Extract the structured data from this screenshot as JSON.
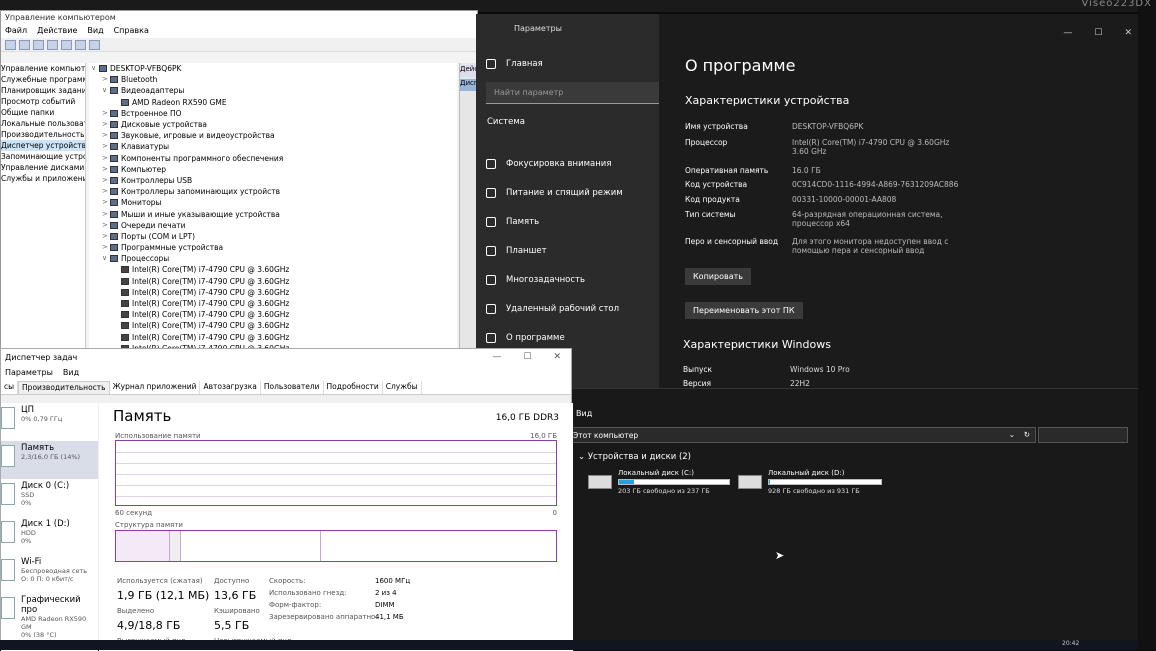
{
  "brand": "Viseo223DX",
  "device_manager": {
    "title": "Управление компьютером",
    "menu": [
      "Файл",
      "Действие",
      "Вид",
      "Справка"
    ],
    "left_items": [
      "Управление компьютером (л",
      "Служебные программы",
      "Планировщик задани",
      "Просмотр событий",
      "Общие папки",
      "Локальные пользовате",
      "Производительность",
      "Диспетчер устройств",
      "Запоминающие устройств",
      "Управление дисками",
      "Службы и приложения"
    ],
    "tree": [
      {
        "arrow": "∨",
        "label": "DESKTOP-VFBQ6PK",
        "indent": 0
      },
      {
        "arrow": ">",
        "label": "Bluetooth",
        "indent": 1
      },
      {
        "arrow": "∨",
        "label": "Видеоадаптеры",
        "indent": 1
      },
      {
        "arrow": "",
        "label": "AMD Radeon RX590 GME",
        "indent": 2
      },
      {
        "arrow": ">",
        "label": "Встроенное ПО",
        "indent": 1
      },
      {
        "arrow": ">",
        "label": "Дисковые устройства",
        "indent": 1
      },
      {
        "arrow": ">",
        "label": "Звуковые, игровые и видеоустройства",
        "indent": 1
      },
      {
        "arrow": ">",
        "label": "Клавиатуры",
        "indent": 1
      },
      {
        "arrow": ">",
        "label": "Компоненты программного обеспечения",
        "indent": 1
      },
      {
        "arrow": ">",
        "label": "Компьютер",
        "indent": 1
      },
      {
        "arrow": ">",
        "label": "Контроллеры USB",
        "indent": 1
      },
      {
        "arrow": ">",
        "label": "Контроллеры запоминающих устройств",
        "indent": 1
      },
      {
        "arrow": ">",
        "label": "Мониторы",
        "indent": 1
      },
      {
        "arrow": ">",
        "label": "Мыши и иные указывающие устройства",
        "indent": 1
      },
      {
        "arrow": ">",
        "label": "Очереди печати",
        "indent": 1
      },
      {
        "arrow": ">",
        "label": "Порты (COM и LPT)",
        "indent": 1
      },
      {
        "arrow": ">",
        "label": "Программные устройства",
        "indent": 1
      },
      {
        "arrow": "∨",
        "label": "Процессоры",
        "indent": 1
      },
      {
        "arrow": "",
        "label": "Intel(R) Core(TM) i7-4790 CPU @ 3.60GHz",
        "indent": 2,
        "cpu": true
      },
      {
        "arrow": "",
        "label": "Intel(R) Core(TM) i7-4790 CPU @ 3.60GHz",
        "indent": 2,
        "cpu": true
      },
      {
        "arrow": "",
        "label": "Intel(R) Core(TM) i7-4790 CPU @ 3.60GHz",
        "indent": 2,
        "cpu": true
      },
      {
        "arrow": "",
        "label": "Intel(R) Core(TM) i7-4790 CPU @ 3.60GHz",
        "indent": 2,
        "cpu": true
      },
      {
        "arrow": "",
        "label": "Intel(R) Core(TM) i7-4790 CPU @ 3.60GHz",
        "indent": 2,
        "cpu": true
      },
      {
        "arrow": "",
        "label": "Intel(R) Core(TM) i7-4790 CPU @ 3.60GHz",
        "indent": 2,
        "cpu": true
      },
      {
        "arrow": "",
        "label": "Intel(R) Core(TM) i7-4790 CPU @ 3.60GHz",
        "indent": 2,
        "cpu": true
      },
      {
        "arrow": "",
        "label": "Intel(R) Core(TM) i7-4790 CPU @ 3.60GHz",
        "indent": 2,
        "cpu": true
      }
    ],
    "right_pane": [
      "Дейс",
      "Дисп"
    ]
  },
  "settings": {
    "app_title": "Параметры",
    "home": "Главная",
    "search_placeholder": "Найти параметр",
    "section": "Система",
    "nav": [
      "Фокусировка внимания",
      "Питание и спящий режим",
      "Память",
      "Планшет",
      "Многозадачность",
      "Удаленный рабочий стол",
      "О программе"
    ],
    "page_title": "О программе",
    "device_specs_title": "Характеристики устройства",
    "specs": [
      {
        "k": "Имя устройства",
        "v": "DESKTOP-VFBQ6PK"
      },
      {
        "k": "Процессор",
        "v": "Intel(R) Core(TM) i7-4790 CPU @ 3.60GHz 3.60 GHz"
      },
      {
        "k": "Оперативная память",
        "v": "16.0 ГБ"
      },
      {
        "k": "Код устройства",
        "v": "0C914CD0-1116-4994-A869-7631209AC886"
      },
      {
        "k": "Код продукта",
        "v": "00331-10000-00001-AA808"
      },
      {
        "k": "Тип системы",
        "v": "64-разрядная операционная система, процессор x64"
      },
      {
        "k": "Перо и сенсорный ввод",
        "v": "Для этого монитора недоступен ввод с помощью пера и сенсорный ввод"
      }
    ],
    "copy_btn": "Копировать",
    "rename_btn": "Переименовать этот ПК",
    "windows_title": "Характеристики Windows",
    "win": [
      {
        "k": "Выпуск",
        "v": "Windows 10 Pro"
      },
      {
        "k": "Версия",
        "v": "22H2"
      }
    ],
    "controls": [
      "—",
      "☐",
      "✕"
    ]
  },
  "task_manager": {
    "title": "Диспетчер задач",
    "menu": [
      "Параметры",
      "Вид"
    ],
    "tabs": [
      "сы",
      "Производительность",
      "Журнал приложений",
      "Автозагрузка",
      "Пользователи",
      "Подробности",
      "Службы"
    ],
    "side": [
      {
        "name": "ЦП",
        "sub": "0% 0,79 ГГц",
        "sub2": ""
      },
      {
        "name": "Память",
        "sub": "2,3/16,0 ГБ (14%)",
        "sub2": ""
      },
      {
        "name": "Диск 0 (C:)",
        "sub": "SSD",
        "sub2": "0%"
      },
      {
        "name": "Диск 1 (D:)",
        "sub": "HDD",
        "sub2": "0%"
      },
      {
        "name": "Wi-Fi",
        "sub": "Беспроводная сеть",
        "sub2": "О: 0 П: 0 кбит/с"
      },
      {
        "name": "Графический про",
        "sub": "AMD Radeon RX590 GM",
        "sub2": "0% (38 °C)"
      }
    ],
    "title_main": "Память",
    "capacity": "16,0 ГБ DDR3",
    "usage_label": "Использование памяти",
    "usage_max": "16,0 ГБ",
    "time_left": "60 секунд",
    "time_right": "0",
    "structure_label": "Структура памяти",
    "stats": {
      "in_use_label": "Используется (сжатая)",
      "in_use": "1,9 ГБ (12,1 МБ)",
      "avail_label": "Доступно",
      "avail": "13,6 ГБ",
      "commit_label": "Выделено",
      "commit": "4,9/18,8 ГБ",
      "cached_label": "Кэшировано",
      "cached": "5,5 ГБ",
      "paged_label": "Выгружаемый пул",
      "nonpaged_label": "Невыгружаемый пул"
    },
    "details": [
      {
        "k": "Скорость:",
        "v": "1600 МГц"
      },
      {
        "k": "Использовано гнезд:",
        "v": "2 из 4"
      },
      {
        "k": "Форм-фактор:",
        "v": "DIMM"
      },
      {
        "k": "Зарезервировано аппаратно:",
        "v": "41,1 МБ"
      }
    ],
    "window_controls": [
      "—",
      "☐",
      "✕"
    ]
  },
  "explorer": {
    "menu": "Вид",
    "path": "Этот компьютер",
    "group": "Устройства и диски (2)",
    "drives": [
      {
        "name": "Локальный диск (C:)",
        "free": "203 ГБ свободно из 237 ГБ",
        "used_fraction": 0.14
      },
      {
        "name": "Локальный диск (D:)",
        "free": "928 ГБ свободно из 931 ГБ",
        "used_fraction": 0.003
      }
    ]
  },
  "clock": "20:42"
}
